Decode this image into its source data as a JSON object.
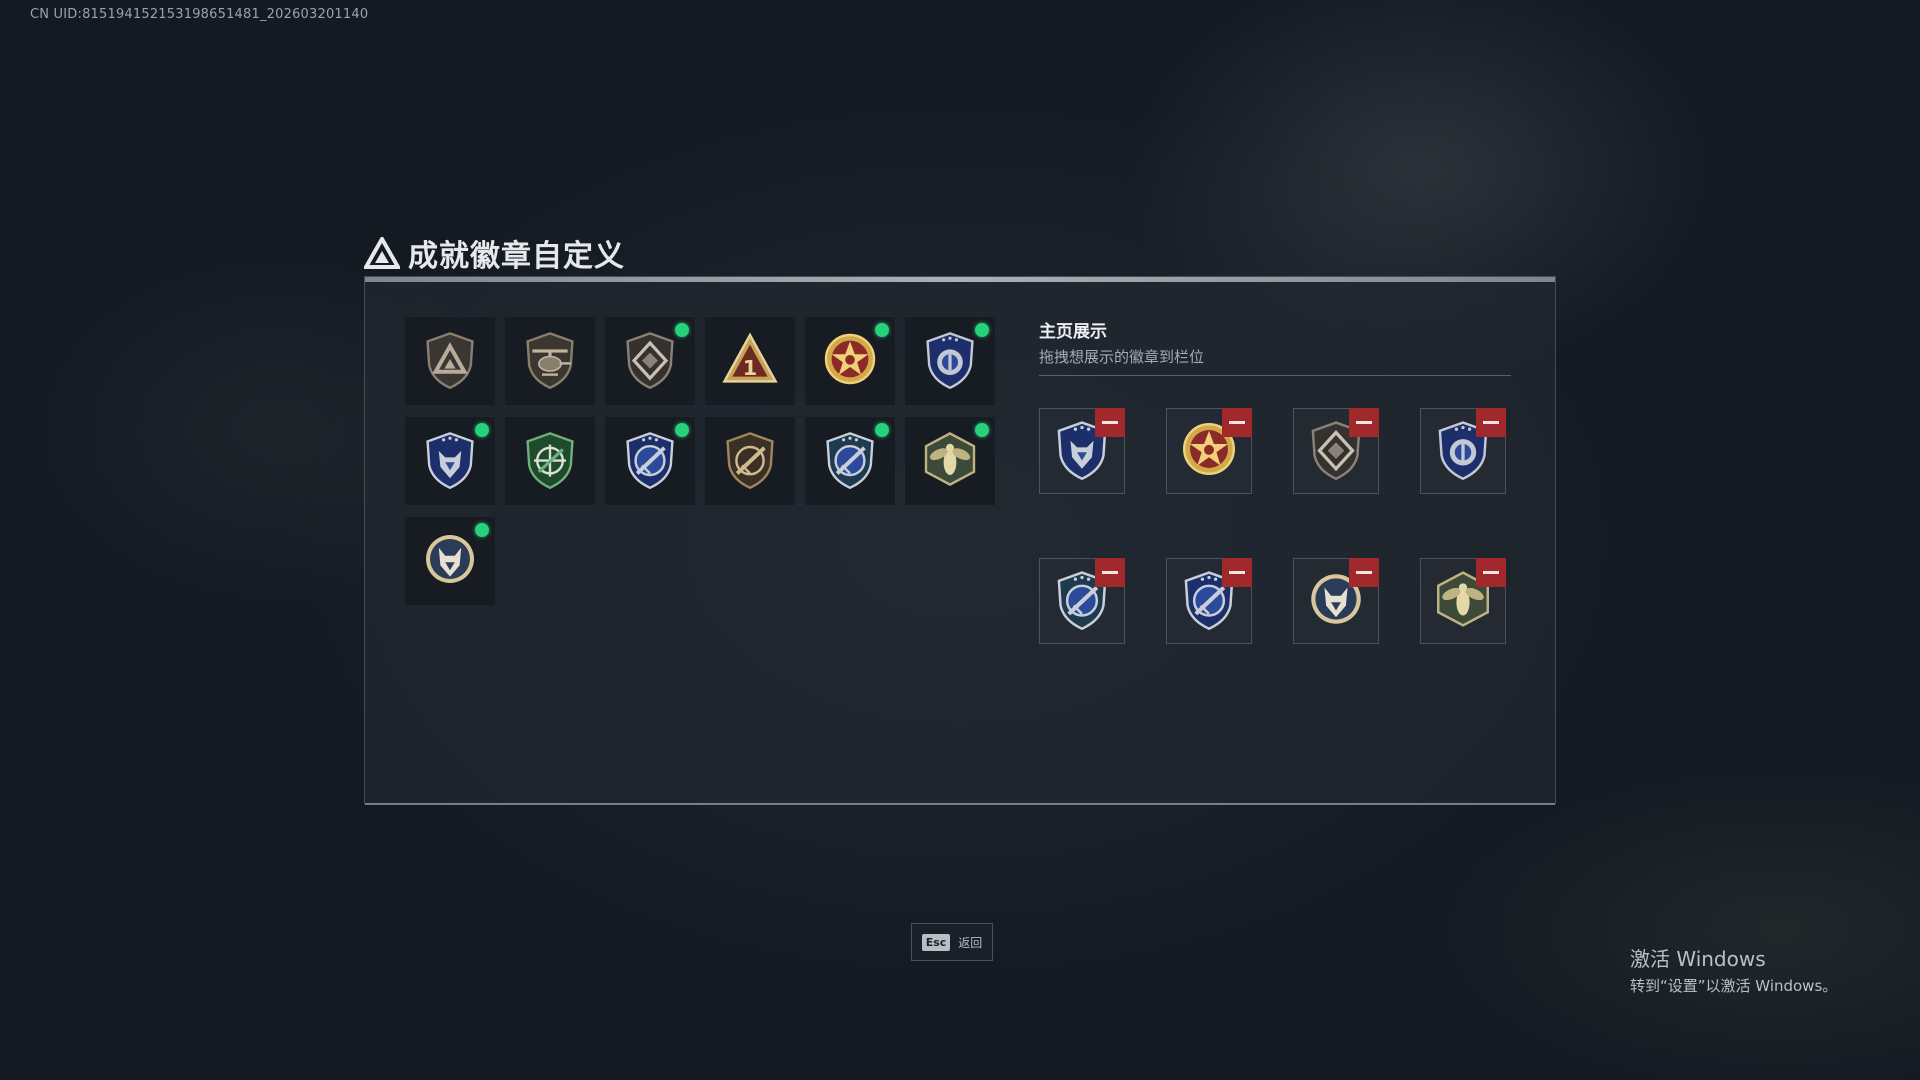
{
  "uid_text": "CN UID:815194152153198651481_202603201140",
  "title": "成就徽章自定义",
  "inventory": [
    {
      "icon": "triangle-shield-badge-icon",
      "kind": "tri-shield",
      "c1": "#3a3632",
      "c2": "#8c7f6f",
      "c3": "#b8ad9c",
      "new": false
    },
    {
      "icon": "helicopter-badge-icon",
      "kind": "heli",
      "c1": "#3a3630",
      "c2": "#8a7e6c",
      "c3": "#c2b59e",
      "new": false
    },
    {
      "icon": "diamond-crest-badge-icon",
      "kind": "diamond",
      "c1": "#34312e",
      "c2": "#8a8178",
      "c3": "#c9c0b4",
      "new": true
    },
    {
      "icon": "number-one-triangle-badge-icon",
      "kind": "one",
      "c1": "#6e2a20",
      "c2": "#c7a25a",
      "c3": "#e9d39a",
      "new": false
    },
    {
      "icon": "star-medal-badge-icon",
      "kind": "star",
      "c1": "#8b2a26",
      "c2": "#d1a84a",
      "c3": "#f0d07a",
      "new": true
    },
    {
      "icon": "blue-crest-shield-badge-icon",
      "kind": "blue-shield",
      "c1": "#1d2f6b",
      "c2": "#c2c8d4",
      "c3": "#2b4a9c",
      "new": true
    },
    {
      "icon": "blue-wolf-shield-badge-icon",
      "kind": "wolf-shield",
      "c1": "#1d2f6b",
      "c2": "#c9cfd9",
      "c3": "#2b4a9c",
      "new": true
    },
    {
      "icon": "green-crosshair-badge-icon",
      "kind": "green-target",
      "c1": "#1f4a2c",
      "c2": "#6fae7d",
      "c3": "#d7e2d6",
      "new": false
    },
    {
      "icon": "blue-rifle-shield-badge-icon",
      "kind": "rifle-shield",
      "c1": "#1d2f6b",
      "c2": "#c9cfd9",
      "c3": "#2b4a9c",
      "new": true
    },
    {
      "icon": "bronze-rifle-shield-badge-icon",
      "kind": "bronze-rifle",
      "c1": "#3a3026",
      "c2": "#a0865c",
      "c3": "#d1ba8d",
      "new": false
    },
    {
      "icon": "teal-rifle-shield-badge-icon",
      "kind": "rifle-shield",
      "c1": "#1e3a4f",
      "c2": "#c9cfd9",
      "c3": "#2b4a9c",
      "new": true
    },
    {
      "icon": "hornet-hexagon-badge-icon",
      "kind": "hornet",
      "c1": "#3d4a3a",
      "c2": "#bfb383",
      "c3": "#e3d8a8",
      "new": true
    },
    {
      "icon": "wolf-round-badge-icon",
      "kind": "wolf-round",
      "c1": "#2a3c57",
      "c2": "#d7c79b",
      "c3": "#e6e1d4",
      "new": true
    }
  ],
  "showcase": {
    "title": "主页展示",
    "subtitle": "拖拽想展示的徽章到栏位",
    "slots": [
      {
        "icon": "blue-wolf-shield-badge-icon",
        "kind": "wolf-shield",
        "c1": "#1d2f6b",
        "c2": "#c9cfd9",
        "c3": "#2b4a9c"
      },
      {
        "icon": "star-medal-badge-icon",
        "kind": "star",
        "c1": "#8b2a26",
        "c2": "#d1a84a",
        "c3": "#f0d07a"
      },
      {
        "icon": "diamond-crest-badge-icon",
        "kind": "diamond",
        "c1": "#34312e",
        "c2": "#8a8178",
        "c3": "#c9c0b4"
      },
      {
        "icon": "blue-crest-shield-badge-icon",
        "kind": "blue-shield",
        "c1": "#1d2f6b",
        "c2": "#c2c8d4",
        "c3": "#2b4a9c"
      },
      {
        "icon": "teal-rifle-shield-badge-icon",
        "kind": "rifle-shield",
        "c1": "#1e3a4f",
        "c2": "#c9cfd9",
        "c3": "#2b4a9c"
      },
      {
        "icon": "blue-rifle-shield-badge-icon",
        "kind": "rifle-shield",
        "c1": "#1d2f6b",
        "c2": "#c9cfd9",
        "c3": "#2b4a9c"
      },
      {
        "icon": "wolf-round-badge-icon",
        "kind": "wolf-round",
        "c1": "#2a3c57",
        "c2": "#d7c79b",
        "c3": "#e6e1d4"
      },
      {
        "icon": "hornet-hexagon-badge-icon",
        "kind": "hornet",
        "c1": "#3d4a3a",
        "c2": "#bfb383",
        "c3": "#e3d8a8"
      }
    ]
  },
  "esc": {
    "key": "Esc",
    "label": "返回"
  },
  "windows_activation": {
    "line1": "激活 Windows",
    "line2": "转到“设置”以激活 Windows。"
  },
  "colors": {
    "new_dot": "#27d07a",
    "remove": "#a1282b"
  }
}
